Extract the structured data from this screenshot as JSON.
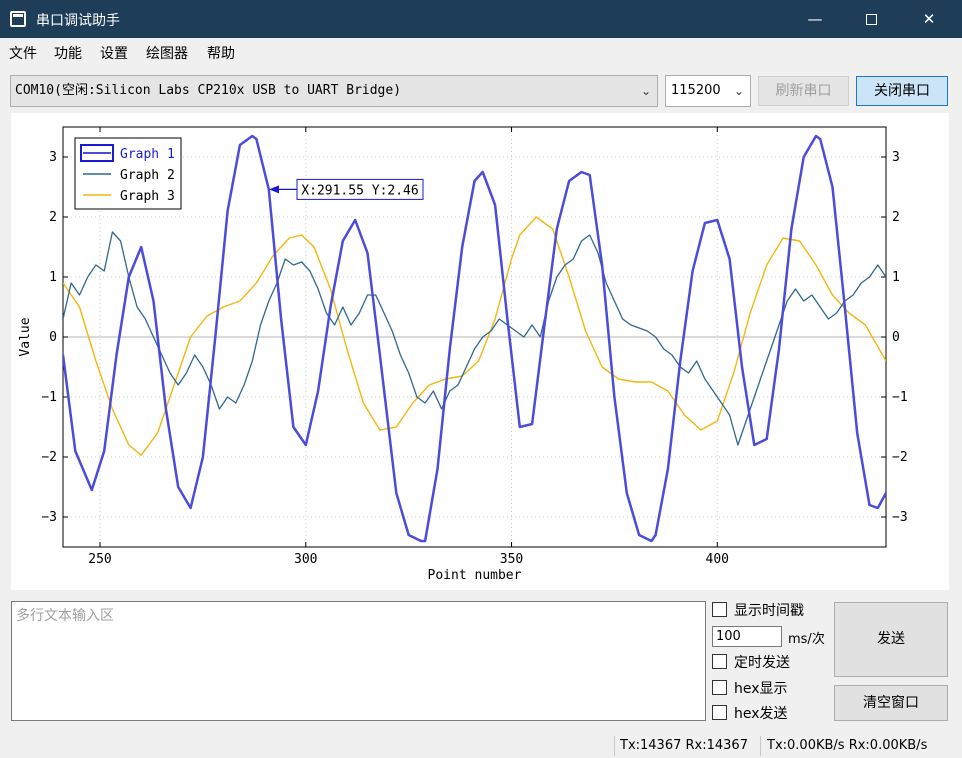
{
  "window": {
    "title": "串口调试助手",
    "min_glyph": "—",
    "close_glyph": "✕"
  },
  "menu": [
    "文件",
    "功能",
    "设置",
    "绘图器",
    "帮助"
  ],
  "toolbar": {
    "port": "COM10(空闲:Silicon Labs CP210x USB to UART Bridge)",
    "baud": "115200",
    "refresh_label": "刷新串口",
    "close_port_label": "关闭串口"
  },
  "chart_data": {
    "type": "line",
    "xlabel": "Point number",
    "ylabel": "Value",
    "xlim": [
      241,
      441
    ],
    "ylim": [
      -3.5,
      3.5
    ],
    "xticks": [
      250,
      300,
      350,
      400
    ],
    "yticks": [
      -3,
      -2,
      -1,
      0,
      1,
      2,
      3
    ],
    "grid": true,
    "legend_placement": "top-left",
    "colors": {
      "Graph 1": "#4b4bdc",
      "Graph 2": "#2f6891",
      "Graph 3": "#f2b70f",
      "cursor": "#1a1ad6"
    },
    "cursor_label": "X:291.55 Y:2.46",
    "series": [
      {
        "name": "Graph 1",
        "x": [
          241,
          244,
          248,
          251,
          254,
          257,
          260,
          263,
          266,
          269,
          272,
          275,
          278,
          281,
          284,
          287,
          288,
          291,
          294,
          297,
          300,
          303,
          306,
          309,
          312,
          315,
          318,
          322,
          325,
          328,
          329,
          332,
          335,
          338,
          341,
          343,
          346,
          349,
          352,
          355,
          358,
          361,
          364,
          367,
          369,
          372,
          375,
          378,
          381,
          384,
          385,
          388,
          391,
          394,
          397,
          400,
          403,
          406,
          409,
          412,
          415,
          418,
          421,
          424,
          425,
          428,
          431,
          434,
          437,
          439,
          441
        ],
        "y": [
          -0.3,
          -1.9,
          -2.55,
          -1.9,
          -0.3,
          1.0,
          1.5,
          0.6,
          -1.2,
          -2.5,
          -2.85,
          -2.0,
          0.0,
          2.1,
          3.2,
          3.35,
          3.3,
          2.46,
          0.3,
          -1.5,
          -1.8,
          -0.9,
          0.5,
          1.6,
          1.95,
          1.4,
          -0.3,
          -2.6,
          -3.3,
          -3.4,
          -3.4,
          -2.2,
          -0.2,
          1.5,
          2.6,
          2.75,
          2.2,
          0.3,
          -1.5,
          -1.45,
          0.2,
          1.8,
          2.6,
          2.75,
          2.7,
          1.2,
          -1.0,
          -2.6,
          -3.3,
          -3.4,
          -3.3,
          -2.2,
          -0.4,
          1.1,
          1.9,
          1.95,
          1.3,
          -0.5,
          -1.8,
          -1.7,
          -0.2,
          1.8,
          3.0,
          3.35,
          3.3,
          2.5,
          0.5,
          -1.6,
          -2.8,
          -2.85,
          -2.6
        ]
      },
      {
        "name": "Graph 2",
        "x": [
          241,
          243,
          245,
          247,
          249,
          251,
          253,
          255,
          257,
          259,
          261,
          263,
          265,
          267,
          269,
          271,
          273,
          275,
          277,
          279,
          281,
          283,
          285,
          287,
          289,
          291,
          293,
          295,
          297,
          299,
          301,
          303,
          305,
          307,
          309,
          311,
          313,
          315,
          317,
          319,
          321,
          323,
          325,
          327,
          329,
          331,
          333,
          335,
          337,
          339,
          341,
          343,
          345,
          347,
          349,
          351,
          353,
          355,
          357,
          359,
          361,
          363,
          365,
          367,
          369,
          371,
          373,
          375,
          377,
          379,
          381,
          383,
          385,
          387,
          389,
          391,
          393,
          395,
          397,
          399,
          401,
          403,
          405,
          407,
          409,
          411,
          413,
          415,
          417,
          419,
          421,
          423,
          425,
          427,
          429,
          431,
          433,
          435,
          437,
          439,
          441
        ],
        "y": [
          0.3,
          0.9,
          0.7,
          1.0,
          1.2,
          1.1,
          1.75,
          1.6,
          1.0,
          0.5,
          0.3,
          0.0,
          -0.3,
          -0.6,
          -0.8,
          -0.6,
          -0.3,
          -0.5,
          -0.8,
          -1.2,
          -1.0,
          -1.1,
          -0.8,
          -0.4,
          0.2,
          0.6,
          0.9,
          1.3,
          1.2,
          1.25,
          1.1,
          0.8,
          0.4,
          0.2,
          0.5,
          0.2,
          0.4,
          0.7,
          0.7,
          0.4,
          0.1,
          -0.3,
          -0.6,
          -1.0,
          -1.1,
          -0.9,
          -1.2,
          -0.9,
          -0.8,
          -0.5,
          -0.2,
          0.0,
          0.1,
          0.3,
          0.2,
          0.1,
          0.0,
          0.2,
          0.0,
          0.6,
          1.0,
          1.2,
          1.3,
          1.6,
          1.7,
          1.4,
          0.9,
          0.6,
          0.3,
          0.2,
          0.15,
          0.1,
          0.0,
          -0.2,
          -0.3,
          -0.5,
          -0.6,
          -0.4,
          -0.7,
          -0.9,
          -1.1,
          -1.3,
          -1.8,
          -1.4,
          -1.0,
          -0.6,
          -0.2,
          0.2,
          0.6,
          0.8,
          0.6,
          0.7,
          0.5,
          0.3,
          0.4,
          0.6,
          0.7,
          0.9,
          1.0,
          1.2,
          1.0
        ]
      },
      {
        "name": "Graph 3",
        "x": [
          241,
          245,
          249,
          253,
          257,
          260,
          264,
          268,
          272,
          276,
          280,
          284,
          288,
          292,
          296,
          299,
          302,
          306,
          310,
          314,
          318,
          322,
          326,
          330,
          334,
          338,
          342,
          346,
          350,
          352,
          356,
          360,
          364,
          368,
          372,
          376,
          380,
          384,
          388,
          392,
          396,
          400,
          404,
          408,
          412,
          416,
          420,
          424,
          428,
          432,
          436,
          441
        ],
        "y": [
          0.9,
          0.5,
          -0.4,
          -1.2,
          -1.8,
          -1.97,
          -1.6,
          -0.8,
          0.0,
          0.35,
          0.5,
          0.6,
          0.9,
          1.35,
          1.65,
          1.7,
          1.5,
          0.8,
          -0.2,
          -1.1,
          -1.55,
          -1.5,
          -1.1,
          -0.8,
          -0.7,
          -0.65,
          -0.4,
          0.3,
          1.3,
          1.7,
          2.0,
          1.8,
          1.0,
          0.1,
          -0.5,
          -0.7,
          -0.75,
          -0.75,
          -0.9,
          -1.3,
          -1.55,
          -1.4,
          -0.6,
          0.4,
          1.2,
          1.65,
          1.6,
          1.2,
          0.7,
          0.4,
          0.2,
          -0.4
        ]
      }
    ]
  },
  "bottom": {
    "input_placeholder": "多行文本输入区",
    "show_timestamp": "显示时间戳",
    "interval_value": "100",
    "interval_unit": "ms/次",
    "timed_send": "定时发送",
    "hex_display": "hex显示",
    "hex_send": "hex发送",
    "send_label": "发送",
    "clear_label": "清空窗口"
  },
  "status": {
    "counts": "Tx:14367 Rx:14367",
    "rates": "Tx:0.00KB/s Rx:0.00KB/s"
  }
}
